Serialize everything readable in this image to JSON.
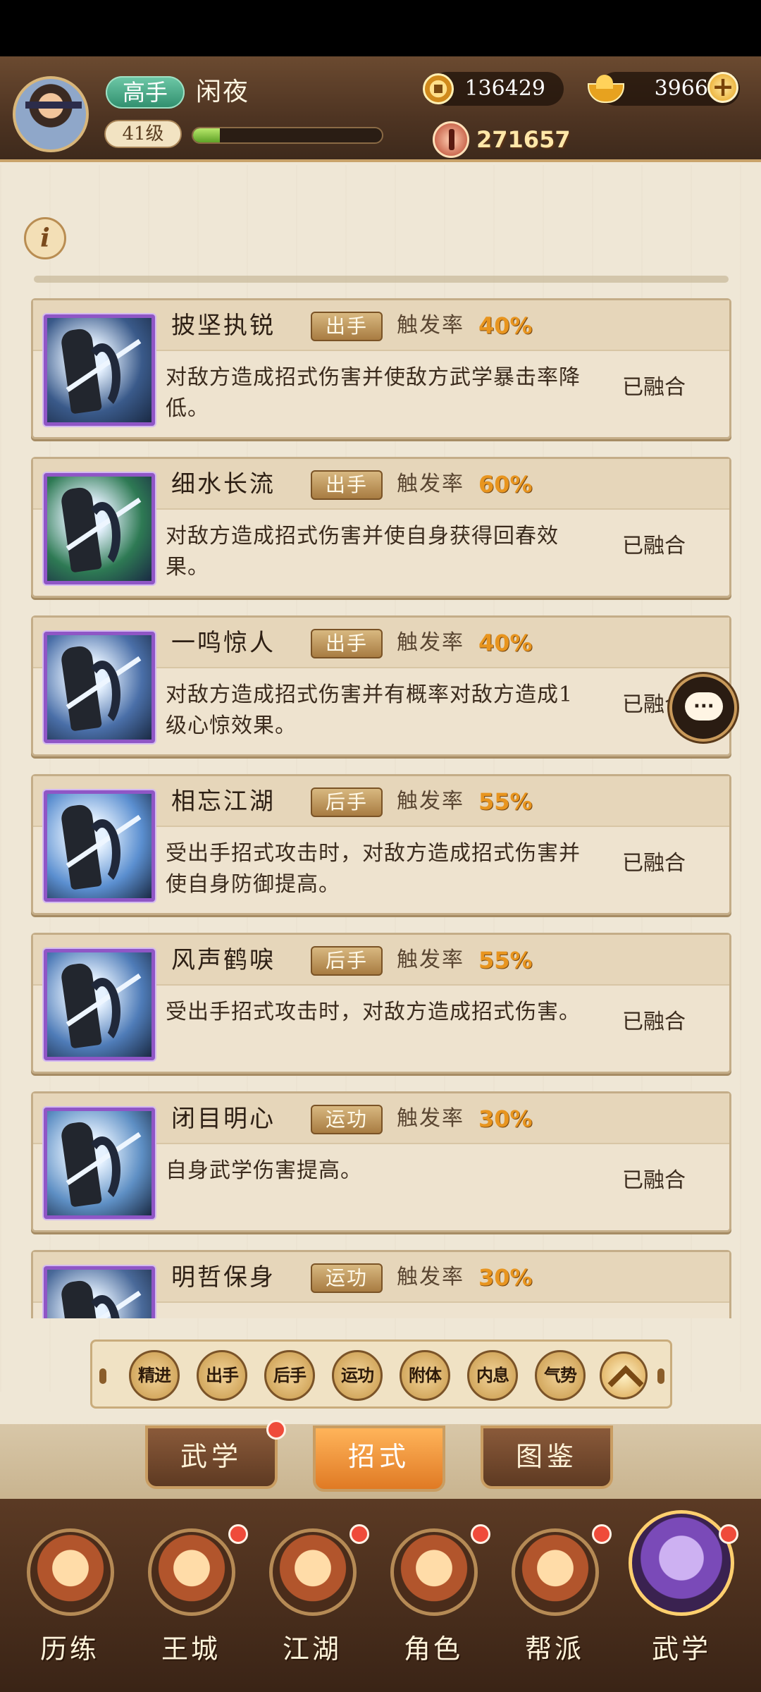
{
  "header": {
    "player_rank": "高手",
    "player_name": "闲夜",
    "level": "41级",
    "exp_fraction": 0.14,
    "coins": "136429",
    "gold": "39666",
    "power": "271657"
  },
  "skills": [
    {
      "name": "披坚执锐",
      "type": "出手",
      "trigger_label": "触发率",
      "trigger_rate": "40%",
      "description": "对敌方造成招式伤害并使敌方武学暴击率降低。",
      "status": "已融合",
      "thumb_color": "#3a5a8a"
    },
    {
      "name": "细水长流",
      "type": "出手",
      "trigger_label": "触发率",
      "trigger_rate": "60%",
      "description": "对敌方造成招式伤害并使自身获得回春效果。",
      "status": "已融合",
      "thumb_color": "#2e7a54"
    },
    {
      "name": "一鸣惊人",
      "type": "出手",
      "trigger_label": "触发率",
      "trigger_rate": "40%",
      "description": "对敌方造成招式伤害并有概率对敌方造成1级心惊效果。",
      "status": "已融合",
      "thumb_color": "#4a6fa8"
    },
    {
      "name": "相忘江湖",
      "type": "后手",
      "trigger_label": "触发率",
      "trigger_rate": "55%",
      "description": "受出手招式攻击时，对敌方造成招式伤害并使自身防御提高。",
      "status": "已融合",
      "thumb_color": "#5b8fd0"
    },
    {
      "name": "风声鹤唳",
      "type": "后手",
      "trigger_label": "触发率",
      "trigger_rate": "55%",
      "description": "受出手招式攻击时，对敌方造成招式伤害。",
      "status": "已融合",
      "thumb_color": "#4f7cb8"
    },
    {
      "name": "闭目明心",
      "type": "运功",
      "trigger_label": "触发率",
      "trigger_rate": "30%",
      "description": "自身武学伤害提高。",
      "status": "已融合",
      "thumb_color": "#5e8fc4"
    },
    {
      "name": "明哲保身",
      "type": "运功",
      "trigger_label": "触发率",
      "trigger_rate": "30%",
      "description": "",
      "status": "",
      "thumb_color": "#4a6a9a"
    }
  ],
  "filters": [
    "精进",
    "出手",
    "后手",
    "运功",
    "附体",
    "内息",
    "气势"
  ],
  "tabs": [
    {
      "label": "武学",
      "badge": true
    },
    {
      "label": "招式",
      "badge": false,
      "active": true
    },
    {
      "label": "图鉴",
      "badge": false
    }
  ],
  "nav": [
    {
      "label": "历练",
      "badge": false
    },
    {
      "label": "王城",
      "badge": true
    },
    {
      "label": "江湖",
      "badge": true
    },
    {
      "label": "角色",
      "badge": true
    },
    {
      "label": "帮派",
      "badge": true
    },
    {
      "label": "武学",
      "badge": true,
      "active": true
    }
  ],
  "icons": {
    "info": "info-icon",
    "chat": "chat-icon",
    "coin": "coin-icon",
    "gold": "gold-ingot-icon",
    "power": "combat-power-icon",
    "plus": "plus-icon",
    "collapse": "chevron-up-icon"
  },
  "colors": {
    "rate": "#e8951f",
    "active_tab": "#e07a24",
    "thumb_border": "#8f56c6",
    "badge": "#ef4b3a"
  }
}
